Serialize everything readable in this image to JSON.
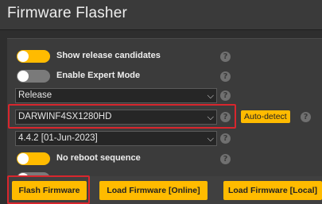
{
  "header": {
    "title": "Firmware Flasher"
  },
  "options": {
    "release_candidates": {
      "label": "Show release candidates",
      "enabled": true
    },
    "expert_mode": {
      "label": "Enable Expert Mode",
      "enabled": false
    },
    "build_type": {
      "value": "Release"
    },
    "board": {
      "value": "DARWINF4SX1280HD"
    },
    "auto_detect_label": "Auto-detect",
    "version": {
      "value": "4.4.2 [01-Jun-2023]"
    },
    "no_reboot": {
      "label": "No reboot sequence",
      "enabled": true
    }
  },
  "help_glyph": "?",
  "chevron_glyph": "⌵",
  "actions": {
    "flash": "Flash Firmware",
    "load_online": "Load Firmware [Online]",
    "load_local": "Load Firmware [Local]"
  },
  "colors": {
    "accent": "#ffbb00",
    "highlight": "#d8262d",
    "background": "#2e2e2e"
  },
  "icons": {
    "help": "help-icon",
    "chevron": "chevron-down-icon"
  }
}
